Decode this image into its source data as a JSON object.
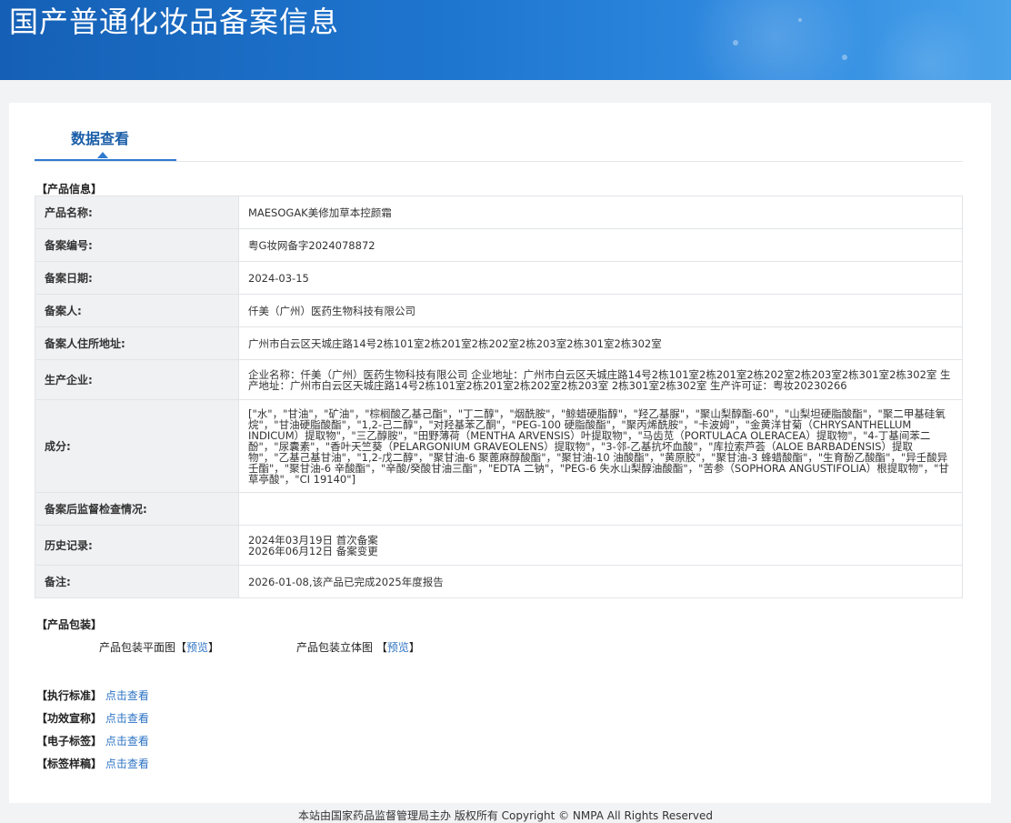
{
  "header": {
    "title": "国产普通化妆品备案信息"
  },
  "tabs": [
    {
      "label": "数据查看"
    }
  ],
  "product_info": {
    "section_title": "【产品信息】",
    "rows": [
      {
        "key": "产品名称:",
        "value": "MAESOGAK美修加草本控颜霜"
      },
      {
        "key": "备案编号:",
        "value": "粤G妆网备字2024078872"
      },
      {
        "key": "备案日期:",
        "value": "2024-03-15"
      },
      {
        "key": "备案人:",
        "value": "仟美（广州）医药生物科技有限公司"
      },
      {
        "key": "备案人住所地址:",
        "value": "广州市白云区天城庄路14号2栋101室2栋201室2栋202室2栋203室2栋301室2栋302室"
      },
      {
        "key": "生产企业:",
        "value": "企业名称：仟美（广州）医药生物科技有限公司 企业地址：广州市白云区天城庄路14号2栋101室2栋201室2栋202室2栋203室2栋301室2栋302室 生产地址：广州市白云区天城庄路14号2栋101室2栋201室2栋202室2栋203室 2栋301室2栋302室 生产许可证：粤妆20230266"
      },
      {
        "key": "成分:",
        "value": "[\"水\"，\"甘油\"，\"矿油\"，\"棕榈酸乙基己酯\"，\"丁二醇\"，\"烟酰胺\"，\"鲸蜡硬脂醇\"，\"羟乙基脲\"，\"聚山梨醇酯-60\"，\"山梨坦硬脂酸酯\"，\"聚二甲基硅氧烷\"，\"甘油硬脂酸酯\"，\"1,2-己二醇\"，\"对羟基苯乙酮\"，\"PEG-100 硬脂酸酯\"，\"聚丙烯酰胺\"，\"卡波姆\"，\"金黄洋甘菊（CHRYSANTHELLUM INDICUM）提取物\"，\"三乙醇胺\"，\"田野薄荷（MENTHA ARVENSIS）叶提取物\"，\"马齿苋（PORTULACA OLERACEA）提取物\"，\"4-丁基间苯二酚\"，\"尿囊素\"，\"香叶天竺葵（PELARGONIUM GRAVEOLENS）提取物\"，\"3-邻-乙基抗坏血酸\"，\"库拉索芦荟（ALOE BARBADENSIS）提取物\"，\"乙基己基甘油\"，\"1,2-戊二醇\"，\"聚甘油-6 聚蓖麻醇酸酯\"，\"聚甘油-10 油酸酯\"，\"黄原胶\"，\"聚甘油-3 蜂蜡酸酯\"，\"生育酚乙酸酯\"，\"异壬酸异壬酯\"，\"聚甘油-6 辛酸酯\"，\"辛酸/癸酸甘油三酯\"，\"EDTA 二钠\"，\"PEG-6 失水山梨醇油酸酯\"，\"苦参（SOPHORA ANGUSTIFOLIA）根提取物\"，\"甘草亭酸\"，\"CI 19140\"]"
      },
      {
        "key": "备案后监督检查情况:",
        "value": ""
      },
      {
        "key": "历史记录:",
        "value_lines": [
          "2024年03月19日 首次备案",
          "2026年06月12日 备案变更"
        ]
      },
      {
        "key": "备注:",
        "value": "2026-01-08,该产品已完成2025年度报告"
      }
    ]
  },
  "packaging": {
    "section_title": "【产品包装】",
    "flat_label": "产品包装平面图",
    "stereo_label": "产品包装立体图",
    "bracket_open": "【",
    "bracket_close": "】",
    "preview": "预览"
  },
  "links": [
    {
      "label": "【执行标准】",
      "action": "点击查看"
    },
    {
      "label": "【功效宣称】",
      "action": "点击查看"
    },
    {
      "label": "【电子标签】",
      "action": "点击查看"
    },
    {
      "label": "【标签样稿】",
      "action": "点击查看"
    }
  ],
  "footer": "本站由国家药品监督管理局主办 版权所有 Copyright © NMPA All Rights Reserved"
}
